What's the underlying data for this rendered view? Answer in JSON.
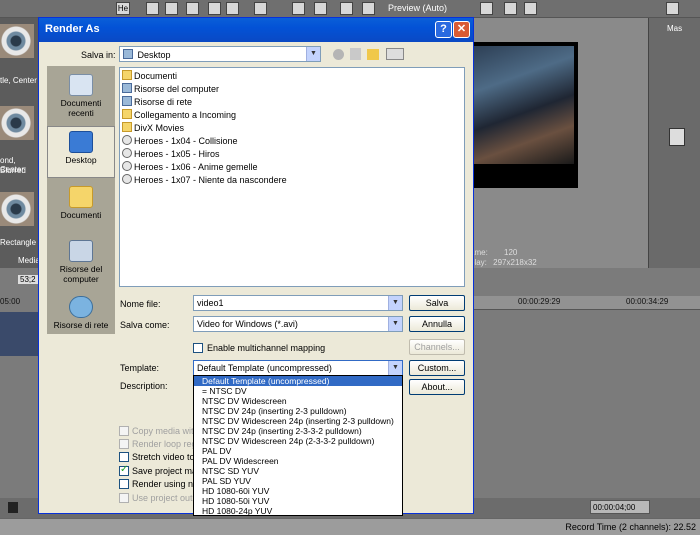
{
  "app": {
    "toolbar_zoom": "He",
    "preview_label": "Preview (Auto)",
    "fx_labels": [
      "tle, Center",
      "ond, Center",
      "Blurred",
      "Rectangle"
    ],
    "media_tab": "Media",
    "frame_label": "ame:",
    "frame_value": "120",
    "display_label": "play:",
    "display_value": "297x218x32",
    "right_panel_label": "Mas",
    "timecodes": [
      "05:00",
      "00:00:29:29",
      "00:00:34:29"
    ],
    "track_label": "53;2",
    "transport_timecode": "00:00:04;00",
    "status_text": "Record Time (2 channels): 22.52"
  },
  "dialog": {
    "title": "Render As",
    "help_label": "?",
    "close_label": "✕",
    "save_in_label": "Salva in:",
    "save_in_value": "Desktop",
    "places": [
      {
        "label": "Documenti recenti",
        "icon": "recent-documents-icon"
      },
      {
        "label": "Desktop",
        "icon": "desktop-icon"
      },
      {
        "label": "Documenti",
        "icon": "documents-icon"
      },
      {
        "label": "Risorse del computer",
        "icon": "my-computer-icon"
      },
      {
        "label": "Risorse di rete",
        "icon": "network-icon"
      }
    ],
    "files": [
      {
        "name": "Documenti",
        "icon": "folder"
      },
      {
        "name": "Risorse del computer",
        "icon": "comp"
      },
      {
        "name": "Risorse di rete",
        "icon": "comp"
      },
      {
        "name": "Collegamento a Incoming",
        "icon": "folder"
      },
      {
        "name": "DivX Movies",
        "icon": "folder"
      },
      {
        "name": "Heroes - 1x04 - Collisione",
        "icon": "clip"
      },
      {
        "name": "Heroes - 1x05 - Hiros",
        "icon": "clip"
      },
      {
        "name": "Heroes - 1x06 - Anime gemelle",
        "icon": "clip"
      },
      {
        "name": "Heroes - 1x07 - Niente da nascondere",
        "icon": "clip"
      }
    ],
    "filename_label": "Nome file:",
    "filename_value": "video1",
    "save_button": "Salva",
    "savetype_label": "Salva come:",
    "savetype_value": "Video for Windows (*.avi)",
    "cancel_button": "Annulla",
    "multichannel_label": "Enable multichannel mapping",
    "channels_button": "Channels...",
    "template_label": "Template:",
    "template_value": "Default Template (uncompressed)",
    "custom_button": "Custom...",
    "description_label": "Description:",
    "about_button": "About...",
    "options": [
      {
        "label": "Copy media with",
        "checked": false,
        "disabled": true
      },
      {
        "label": "Render loop regi",
        "checked": false,
        "disabled": true
      },
      {
        "label": "Stretch video to f",
        "checked": false,
        "disabled": false
      },
      {
        "label": "Save project mar",
        "checked": true,
        "disabled": false
      },
      {
        "label": "Render using net",
        "checked": false,
        "disabled": false
      },
      {
        "label": "Use project outpu",
        "checked": false,
        "disabled": true
      }
    ],
    "template_options": [
      {
        "label": "Default Template (uncompressed)",
        "selected": true
      },
      {
        "label": "= NTSC DV",
        "selected": false
      },
      {
        "label": "NTSC DV Widescreen",
        "selected": false
      },
      {
        "label": "NTSC DV 24p (inserting 2-3 pulldown)",
        "selected": false
      },
      {
        "label": "NTSC DV Widescreen 24p (inserting 2-3 pulldown)",
        "selected": false
      },
      {
        "label": "NTSC DV 24p (inserting 2-3-3-2 pulldown)",
        "selected": false
      },
      {
        "label": "NTSC DV Widescreen 24p (2-3-3-2 pulldown)",
        "selected": false
      },
      {
        "label": "PAL DV",
        "selected": false
      },
      {
        "label": "PAL DV Widescreen",
        "selected": false
      },
      {
        "label": "NTSC SD YUV",
        "selected": false
      },
      {
        "label": "PAL SD YUV",
        "selected": false
      },
      {
        "label": "HD 1080-60i YUV",
        "selected": false
      },
      {
        "label": "HD 1080-50i YUV",
        "selected": false
      },
      {
        "label": "HD 1080-24p YUV",
        "selected": false
      }
    ]
  }
}
